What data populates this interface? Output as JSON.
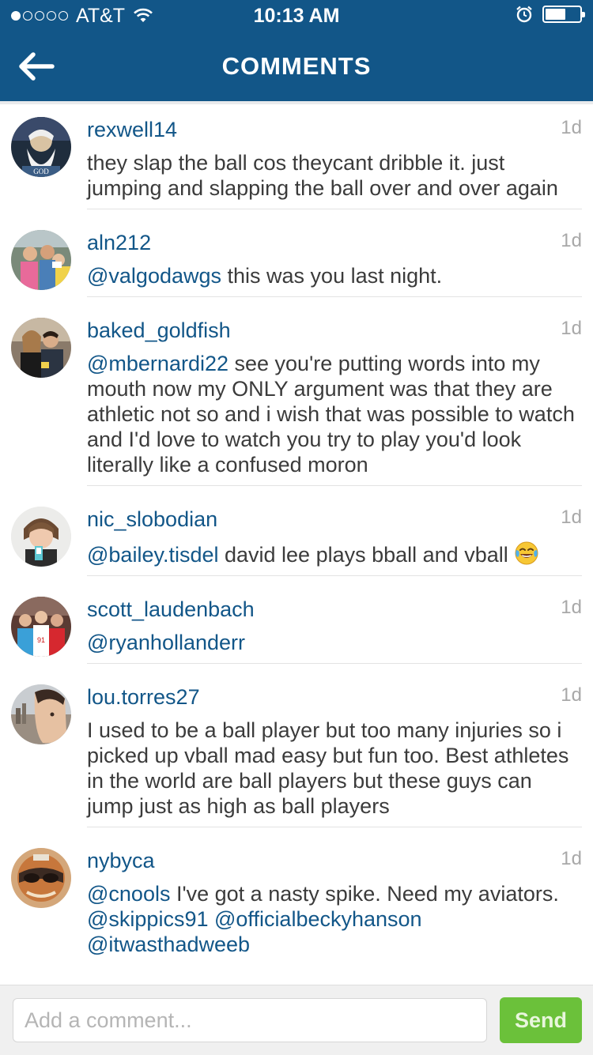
{
  "status_bar": {
    "carrier": "AT&T",
    "signal_dots_filled": 1,
    "signal_dots_total": 5,
    "time": "10:13 AM",
    "battery_level": 0.6
  },
  "nav": {
    "title": "COMMENTS",
    "back_icon": "back-arrow-icon"
  },
  "comments": [
    {
      "user": "rexwell14",
      "time": "1d",
      "parts": [
        {
          "t": "they slap the ball cos theycant dribble it. just jumping and slapping the ball over and over again"
        }
      ]
    },
    {
      "user": "aln212",
      "time": "1d",
      "parts": [
        {
          "m": "@valgodawgs"
        },
        {
          "t": " this was you last night."
        }
      ]
    },
    {
      "user": "baked_goldfish",
      "time": "1d",
      "parts": [
        {
          "m": "@mbernardi22"
        },
        {
          "t": " see you're putting words into my mouth now my ONLY argument was that they are athletic not so and i wish that was possible to watch and I'd love to watch you try to play you'd look literally like a confused moron"
        }
      ]
    },
    {
      "user": "nic_slobodian",
      "time": "1d",
      "parts": [
        {
          "m": "@bailey.tisdel"
        },
        {
          "t": "  david lee plays bball and vball "
        },
        {
          "e": "tears-of-joy-emoji"
        }
      ]
    },
    {
      "user": "scott_laudenbach",
      "time": "1d",
      "parts": [
        {
          "m": "@ryanhollanderr"
        }
      ]
    },
    {
      "user": "lou.torres27",
      "time": "1d",
      "parts": [
        {
          "t": "I used to be a ball player but too many injuries so i picked up vball mad easy but fun too. Best athletes in the world are ball players but these guys can jump just as high as ball players"
        }
      ]
    },
    {
      "user": "nybyca",
      "time": "1d",
      "parts": [
        {
          "m": "@cnools"
        },
        {
          "t": " I've got a nasty spike. Need my aviators. "
        },
        {
          "m": "@skippics91"
        },
        {
          "t": " "
        },
        {
          "m": "@officialbeckyhanson"
        },
        {
          "t": " "
        },
        {
          "m": "@itwasthadweeb"
        }
      ]
    }
  ],
  "composer": {
    "placeholder": "Add a comment...",
    "send_label": "Send"
  },
  "colors": {
    "brand": "#125688",
    "send": "#6bc13a",
    "timestamp": "#a8a8a8",
    "text": "#3b3b3b"
  }
}
